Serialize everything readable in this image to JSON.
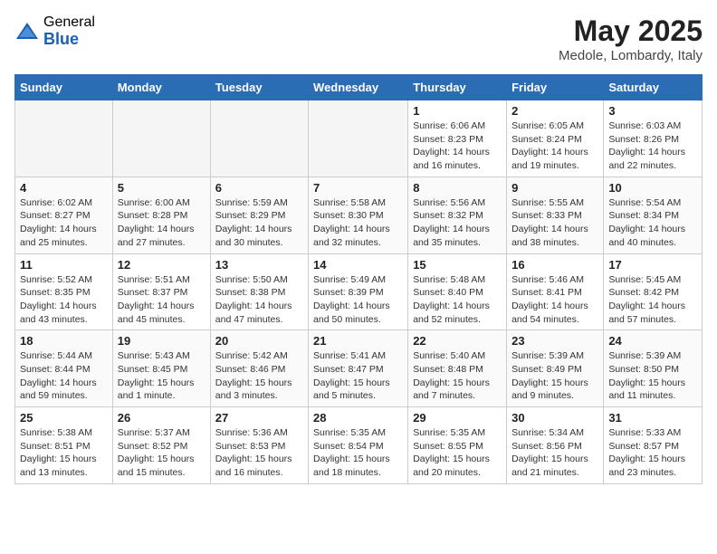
{
  "header": {
    "logo_general": "General",
    "logo_blue": "Blue",
    "month": "May 2025",
    "location": "Medole, Lombardy, Italy"
  },
  "weekdays": [
    "Sunday",
    "Monday",
    "Tuesday",
    "Wednesday",
    "Thursday",
    "Friday",
    "Saturday"
  ],
  "weeks": [
    [
      {
        "day": "",
        "empty": true
      },
      {
        "day": "",
        "empty": true
      },
      {
        "day": "",
        "empty": true
      },
      {
        "day": "",
        "empty": true
      },
      {
        "day": "1",
        "sunrise": "6:06 AM",
        "sunset": "8:23 PM",
        "daylight": "14 hours and 16 minutes."
      },
      {
        "day": "2",
        "sunrise": "6:05 AM",
        "sunset": "8:24 PM",
        "daylight": "14 hours and 19 minutes."
      },
      {
        "day": "3",
        "sunrise": "6:03 AM",
        "sunset": "8:26 PM",
        "daylight": "14 hours and 22 minutes."
      }
    ],
    [
      {
        "day": "4",
        "sunrise": "6:02 AM",
        "sunset": "8:27 PM",
        "daylight": "14 hours and 25 minutes."
      },
      {
        "day": "5",
        "sunrise": "6:00 AM",
        "sunset": "8:28 PM",
        "daylight": "14 hours and 27 minutes."
      },
      {
        "day": "6",
        "sunrise": "5:59 AM",
        "sunset": "8:29 PM",
        "daylight": "14 hours and 30 minutes."
      },
      {
        "day": "7",
        "sunrise": "5:58 AM",
        "sunset": "8:30 PM",
        "daylight": "14 hours and 32 minutes."
      },
      {
        "day": "8",
        "sunrise": "5:56 AM",
        "sunset": "8:32 PM",
        "daylight": "14 hours and 35 minutes."
      },
      {
        "day": "9",
        "sunrise": "5:55 AM",
        "sunset": "8:33 PM",
        "daylight": "14 hours and 38 minutes."
      },
      {
        "day": "10",
        "sunrise": "5:54 AM",
        "sunset": "8:34 PM",
        "daylight": "14 hours and 40 minutes."
      }
    ],
    [
      {
        "day": "11",
        "sunrise": "5:52 AM",
        "sunset": "8:35 PM",
        "daylight": "14 hours and 43 minutes."
      },
      {
        "day": "12",
        "sunrise": "5:51 AM",
        "sunset": "8:37 PM",
        "daylight": "14 hours and 45 minutes."
      },
      {
        "day": "13",
        "sunrise": "5:50 AM",
        "sunset": "8:38 PM",
        "daylight": "14 hours and 47 minutes."
      },
      {
        "day": "14",
        "sunrise": "5:49 AM",
        "sunset": "8:39 PM",
        "daylight": "14 hours and 50 minutes."
      },
      {
        "day": "15",
        "sunrise": "5:48 AM",
        "sunset": "8:40 PM",
        "daylight": "14 hours and 52 minutes."
      },
      {
        "day": "16",
        "sunrise": "5:46 AM",
        "sunset": "8:41 PM",
        "daylight": "14 hours and 54 minutes."
      },
      {
        "day": "17",
        "sunrise": "5:45 AM",
        "sunset": "8:42 PM",
        "daylight": "14 hours and 57 minutes."
      }
    ],
    [
      {
        "day": "18",
        "sunrise": "5:44 AM",
        "sunset": "8:44 PM",
        "daylight": "14 hours and 59 minutes."
      },
      {
        "day": "19",
        "sunrise": "5:43 AM",
        "sunset": "8:45 PM",
        "daylight": "15 hours and 1 minute."
      },
      {
        "day": "20",
        "sunrise": "5:42 AM",
        "sunset": "8:46 PM",
        "daylight": "15 hours and 3 minutes."
      },
      {
        "day": "21",
        "sunrise": "5:41 AM",
        "sunset": "8:47 PM",
        "daylight": "15 hours and 5 minutes."
      },
      {
        "day": "22",
        "sunrise": "5:40 AM",
        "sunset": "8:48 PM",
        "daylight": "15 hours and 7 minutes."
      },
      {
        "day": "23",
        "sunrise": "5:39 AM",
        "sunset": "8:49 PM",
        "daylight": "15 hours and 9 minutes."
      },
      {
        "day": "24",
        "sunrise": "5:39 AM",
        "sunset": "8:50 PM",
        "daylight": "15 hours and 11 minutes."
      }
    ],
    [
      {
        "day": "25",
        "sunrise": "5:38 AM",
        "sunset": "8:51 PM",
        "daylight": "15 hours and 13 minutes."
      },
      {
        "day": "26",
        "sunrise": "5:37 AM",
        "sunset": "8:52 PM",
        "daylight": "15 hours and 15 minutes."
      },
      {
        "day": "27",
        "sunrise": "5:36 AM",
        "sunset": "8:53 PM",
        "daylight": "15 hours and 16 minutes."
      },
      {
        "day": "28",
        "sunrise": "5:35 AM",
        "sunset": "8:54 PM",
        "daylight": "15 hours and 18 minutes."
      },
      {
        "day": "29",
        "sunrise": "5:35 AM",
        "sunset": "8:55 PM",
        "daylight": "15 hours and 20 minutes."
      },
      {
        "day": "30",
        "sunrise": "5:34 AM",
        "sunset": "8:56 PM",
        "daylight": "15 hours and 21 minutes."
      },
      {
        "day": "31",
        "sunrise": "5:33 AM",
        "sunset": "8:57 PM",
        "daylight": "15 hours and 23 minutes."
      }
    ]
  ]
}
